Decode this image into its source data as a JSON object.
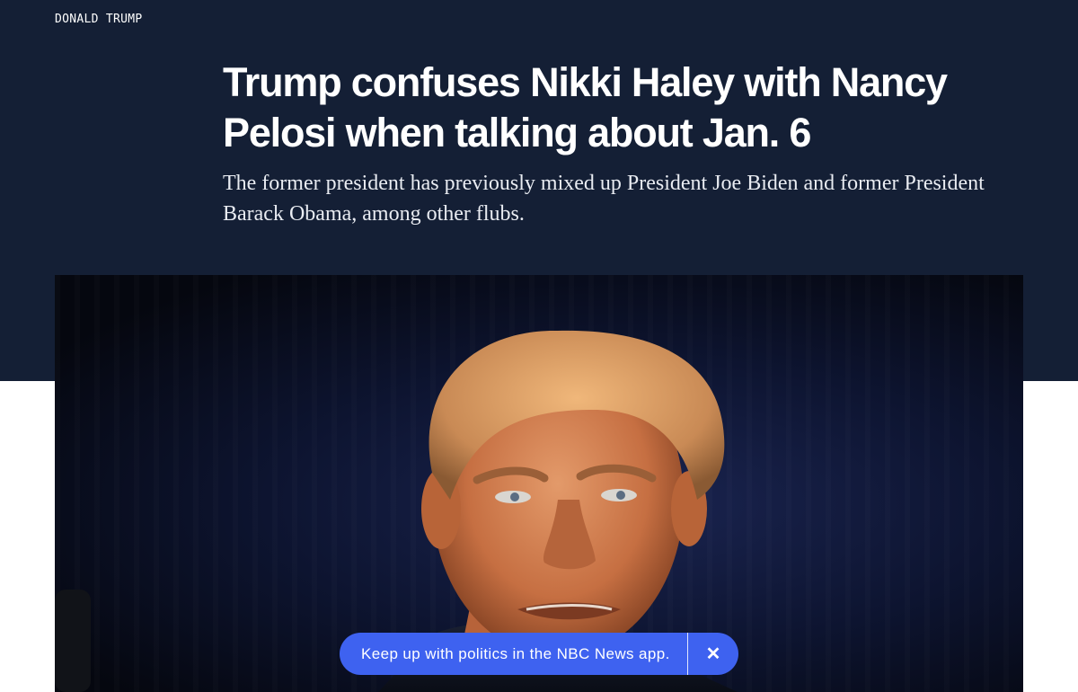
{
  "section": {
    "label": "DONALD TRUMP"
  },
  "article": {
    "headline": "Trump confuses Nikki Haley with Nancy Pelosi when talking about Jan. 6",
    "dek": "The former president has previously mixed up President Joe Biden and former President Barack Obama, among other flubs."
  },
  "app_banner": {
    "text": "Keep up with politics in the NBC News app.",
    "close_icon": "close-icon",
    "close_glyph": "✕"
  },
  "colors": {
    "header_background": "#141f35",
    "banner_accent": "#3e62f0"
  }
}
